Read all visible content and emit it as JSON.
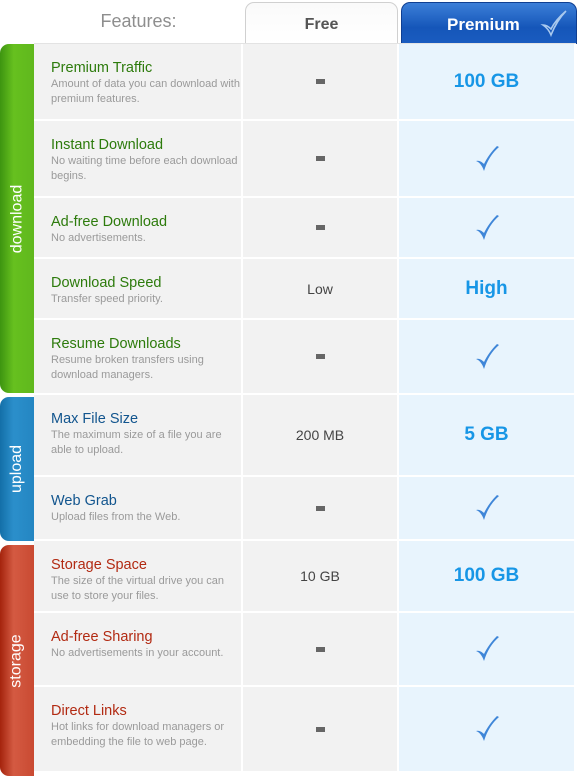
{
  "header": {
    "features_label": "Features:",
    "free_label": "Free",
    "premium_label": "Premium",
    "premium_icon": "check-icon"
  },
  "groups": [
    {
      "label": "download",
      "color": "#5cb81c",
      "rows": [
        {
          "title": "Premium Traffic",
          "desc": "Amount of data you can download with premium features.",
          "free": "-",
          "premium": "100 GB"
        },
        {
          "title": "Instant Download",
          "desc": "No waiting time before each download begins.",
          "free": "-",
          "premium": "check"
        },
        {
          "title": "Ad-free Download",
          "desc": "No advertisements.",
          "free": "-",
          "premium": "check"
        },
        {
          "title": "Download Speed",
          "desc": "Transfer speed priority.",
          "free": "Low",
          "premium": "High"
        },
        {
          "title": "Resume Downloads",
          "desc": "Resume broken transfers using download managers.",
          "free": "-",
          "premium": "check"
        }
      ]
    },
    {
      "label": "upload",
      "color": "#2486c2",
      "rows": [
        {
          "title": "Max File Size",
          "desc": "The maximum size of a file you are able to upload.",
          "free": "200 MB",
          "premium": "5 GB"
        },
        {
          "title": "Web Grab",
          "desc": "Upload files from the Web.",
          "free": "-",
          "premium": "check"
        }
      ]
    },
    {
      "label": "storage",
      "color": "#c94a32",
      "rows": [
        {
          "title": "Storage Space",
          "desc": "The size of the virtual drive you can use to store your files.",
          "free": "10 GB",
          "premium": "100 GB"
        },
        {
          "title": "Ad-free Sharing",
          "desc": "No advertisements in your account.",
          "free": "-",
          "premium": "check"
        },
        {
          "title": "Direct Links",
          "desc": "Hot links for download managers or embedding the file to web page.",
          "free": "-",
          "premium": "check"
        }
      ]
    }
  ]
}
